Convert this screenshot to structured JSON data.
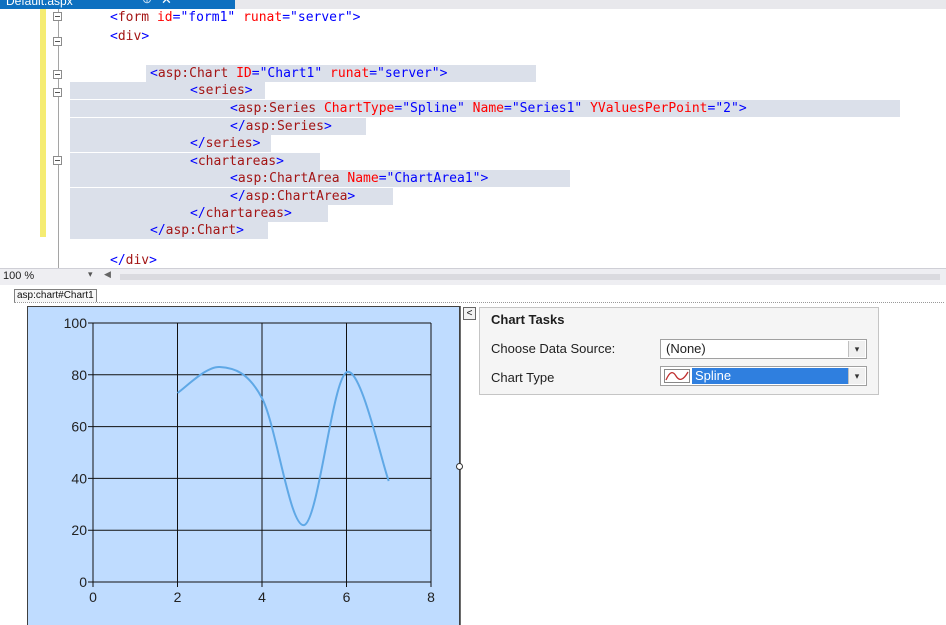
{
  "document_tab": {
    "title": "Default.aspx",
    "pin_glyph": "⊕",
    "close_glyph": "✕"
  },
  "editor": {
    "lines": [
      {
        "id": "form",
        "parts": [
          [
            "br",
            "<"
          ],
          [
            "tag",
            "form"
          ],
          [
            "plain",
            " "
          ],
          [
            "attr",
            "id"
          ],
          [
            "br",
            "="
          ],
          [
            "val",
            "\"form1\""
          ],
          [
            "plain",
            " "
          ],
          [
            "attr",
            "runat"
          ],
          [
            "br",
            "="
          ],
          [
            "val",
            "\"server\""
          ],
          [
            "br",
            ">"
          ]
        ]
      },
      {
        "id": "div-open",
        "parts": [
          [
            "br",
            "<"
          ],
          [
            "tag",
            "div"
          ],
          [
            "br",
            ">"
          ]
        ]
      },
      {
        "id": "blank",
        "parts": []
      },
      {
        "id": "chart-open",
        "parts": [
          [
            "br",
            "<"
          ],
          [
            "tag",
            "asp:Chart"
          ],
          [
            "plain",
            " "
          ],
          [
            "attr",
            "ID"
          ],
          [
            "br",
            "="
          ],
          [
            "val",
            "\"Chart1\""
          ],
          [
            "plain",
            " "
          ],
          [
            "attr",
            "runat"
          ],
          [
            "br",
            "="
          ],
          [
            "val",
            "\"server\""
          ],
          [
            "br",
            ">"
          ]
        ]
      },
      {
        "id": "series-open",
        "parts": [
          [
            "br",
            "<"
          ],
          [
            "tag",
            "series"
          ],
          [
            "br",
            ">"
          ]
        ]
      },
      {
        "id": "series-item",
        "parts": [
          [
            "br",
            "<"
          ],
          [
            "tag",
            "asp:Series"
          ],
          [
            "plain",
            " "
          ],
          [
            "attr",
            "ChartType"
          ],
          [
            "br",
            "="
          ],
          [
            "val",
            "\"Spline\""
          ],
          [
            "plain",
            " "
          ],
          [
            "attr",
            "Name"
          ],
          [
            "br",
            "="
          ],
          [
            "val",
            "\"Series1\""
          ],
          [
            "plain",
            " "
          ],
          [
            "attr",
            "YValuesPerPoint"
          ],
          [
            "br",
            "="
          ],
          [
            "val",
            "\"2\""
          ],
          [
            "br",
            ">"
          ]
        ]
      },
      {
        "id": "series-item-close",
        "parts": [
          [
            "br",
            "</"
          ],
          [
            "tag",
            "asp:Series"
          ],
          [
            "br",
            ">"
          ]
        ]
      },
      {
        "id": "series-close",
        "parts": [
          [
            "br",
            "</"
          ],
          [
            "tag",
            "series"
          ],
          [
            "br",
            ">"
          ]
        ]
      },
      {
        "id": "chartareas-open",
        "parts": [
          [
            "br",
            "<"
          ],
          [
            "tag",
            "chartareas"
          ],
          [
            "br",
            ">"
          ]
        ]
      },
      {
        "id": "chartarea-item",
        "parts": [
          [
            "br",
            "<"
          ],
          [
            "tag",
            "asp:ChartArea"
          ],
          [
            "plain",
            " "
          ],
          [
            "attr",
            "Name"
          ],
          [
            "br",
            "="
          ],
          [
            "val",
            "\"ChartArea1\""
          ],
          [
            "br",
            ">"
          ]
        ]
      },
      {
        "id": "chartarea-item-close",
        "parts": [
          [
            "br",
            "</"
          ],
          [
            "tag",
            "asp:ChartArea"
          ],
          [
            "br",
            ">"
          ]
        ]
      },
      {
        "id": "chartareas-close",
        "parts": [
          [
            "br",
            "</"
          ],
          [
            "tag",
            "chartareas"
          ],
          [
            "br",
            ">"
          ]
        ]
      },
      {
        "id": "chart-close",
        "parts": [
          [
            "br",
            "</"
          ],
          [
            "tag",
            "asp:Chart"
          ],
          [
            "br",
            ">"
          ]
        ]
      },
      {
        "id": "blank2",
        "parts": []
      },
      {
        "id": "div-close",
        "parts": [
          [
            "br",
            "</"
          ],
          [
            "tag",
            "div"
          ],
          [
            "br",
            ">"
          ]
        ]
      }
    ]
  },
  "zoom_bar": {
    "zoom_value": "100 %",
    "dropdown_glyph": "▾",
    "scroll_left_glyph": "◀"
  },
  "designer": {
    "breadcrumb": "asp:chart#Chart1",
    "tasks_toggle_glyph": "<",
    "tasks": {
      "title": "Chart Tasks",
      "data_source_label": "Choose Data Source:",
      "data_source_value": "(None)",
      "chart_type_label": "Chart Type",
      "chart_type_value": "Spline",
      "chart_type_icon": "spline-chart-icon",
      "dropdown_glyph": "▾"
    }
  },
  "chart_data": {
    "type": "line",
    "title": "",
    "xlabel": "",
    "ylabel": "",
    "xlim": [
      0,
      8
    ],
    "ylim": [
      0,
      100
    ],
    "xticks": [
      0,
      2,
      4,
      6,
      8
    ],
    "yticks": [
      0,
      20,
      40,
      60,
      80,
      100
    ],
    "grid": true,
    "colors": {
      "background": "#bfdcff",
      "line": "#5fa8e6",
      "grid": "#111111"
    },
    "series": [
      {
        "x": [
          2,
          3,
          4,
          5,
          6,
          7
        ],
        "values": [
          73,
          83,
          71,
          22,
          81,
          39
        ]
      }
    ]
  }
}
